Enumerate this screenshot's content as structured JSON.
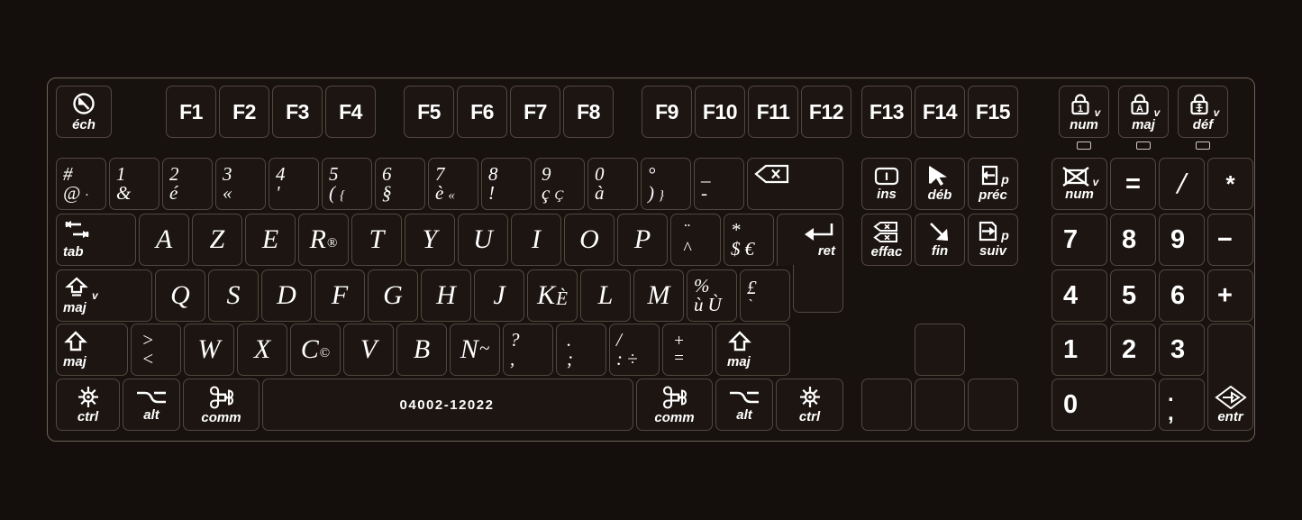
{
  "device": {
    "title": "French AZERTY Apple keyboard sticker overlay",
    "part_number": "04002-12022",
    "background_color": "#140f0c",
    "key_fill_color": "#1c1511",
    "key_border_color": "#52483f",
    "label_color": "#ffffff"
  },
  "function_row": {
    "escape": {
      "label": "éch",
      "icon": "escape-circle-arrow-icon"
    },
    "group_1": [
      "F1",
      "F2",
      "F3",
      "F4"
    ],
    "group_2": [
      "F5",
      "F6",
      "F7",
      "F8"
    ],
    "group_3": [
      "F9",
      "F10",
      "F11",
      "F12"
    ],
    "group_4": [
      "F13",
      "F14",
      "F15"
    ],
    "locks": [
      {
        "label": "num",
        "inner": "1",
        "tag": "v",
        "icon": "padlock-num-icon",
        "led": true
      },
      {
        "label": "maj",
        "inner": "A",
        "tag": "v",
        "icon": "padlock-caps-icon",
        "led": true
      },
      {
        "label": "déf",
        "inner": "",
        "tag": "v",
        "icon": "padlock-scroll-icon",
        "led": true
      }
    ]
  },
  "number_row": [
    {
      "upper": "#",
      "lower": "@",
      "extra_lower": "·"
    },
    {
      "upper": "1",
      "lower": "&"
    },
    {
      "upper": "2",
      "lower": "é"
    },
    {
      "upper": "3",
      "lower": "«"
    },
    {
      "upper": "4",
      "lower": "'"
    },
    {
      "upper": "5",
      "lower": "(",
      "extra_lower": "{"
    },
    {
      "upper": "6",
      "lower": "§"
    },
    {
      "upper": "7",
      "lower": "è",
      "extra_lower": "«"
    },
    {
      "upper": "8",
      "lower": "!"
    },
    {
      "upper": "9",
      "lower": "ç",
      "extra_lower": "Ç"
    },
    {
      "upper": "0",
      "lower": "à"
    },
    {
      "upper": "°",
      "lower": ")",
      "extra_lower": "}"
    },
    {
      "upper": "_",
      "lower": "-"
    }
  ],
  "backspace": {
    "icon": "backspace-arrow-x-icon",
    "label": ""
  },
  "row_azerty": {
    "tab": {
      "label": "tab",
      "icon": "tab-arrows-icon"
    },
    "keys": [
      {
        "letter": "A"
      },
      {
        "letter": "Z"
      },
      {
        "letter": "E"
      },
      {
        "letter": "R",
        "mark": "®"
      },
      {
        "letter": "T"
      },
      {
        "letter": "Y"
      },
      {
        "letter": "U"
      },
      {
        "letter": "I"
      },
      {
        "letter": "O"
      },
      {
        "letter": "P"
      }
    ],
    "dead_key": {
      "upper": "¨",
      "lower": "^"
    },
    "currency_key": {
      "upper": "*",
      "lower": "$",
      "extra_lower": "€"
    },
    "return": {
      "label": "ret",
      "icon": "return-arrow-icon"
    }
  },
  "row_home": {
    "caps_lock": {
      "label": "maj",
      "tag": "v",
      "icon": "caps-lock-outline-arrow-icon"
    },
    "keys": [
      {
        "letter": "Q"
      },
      {
        "letter": "S"
      },
      {
        "letter": "D"
      },
      {
        "letter": "F"
      },
      {
        "letter": "G"
      },
      {
        "letter": "H"
      },
      {
        "letter": "J"
      },
      {
        "letter": "K",
        "accent": "È"
      },
      {
        "letter": "L"
      },
      {
        "letter": "M"
      }
    ],
    "percent_key": {
      "upper": "%",
      "lower": "ù",
      "extra_lower": "Ù"
    },
    "pound_key": {
      "upper": "£",
      "lower": "`"
    }
  },
  "row_bottom": {
    "shift_left": {
      "label": "maj",
      "icon": "shift-arrow-icon"
    },
    "angle_key": {
      "upper": ">",
      "lower": "<"
    },
    "keys": [
      {
        "letter": "W"
      },
      {
        "letter": "X"
      },
      {
        "letter": "C",
        "mark": "©"
      },
      {
        "letter": "V"
      },
      {
        "letter": "B"
      },
      {
        "letter": "N",
        "mark": "~"
      }
    ],
    "punct": [
      {
        "upper": "?",
        "lower": ","
      },
      {
        "upper": ".",
        "lower": ";"
      },
      {
        "upper": "/",
        "lower": ":",
        "extra_lower": "÷"
      },
      {
        "upper": "+",
        "lower": "="
      }
    ],
    "shift_right": {
      "label": "maj",
      "icon": "shift-arrow-icon"
    }
  },
  "row_modifiers": {
    "ctrl_left": {
      "label": "ctrl",
      "icon": "control-wheel-icon"
    },
    "alt_left": {
      "label": "alt",
      "icon": "option-alt-icon"
    },
    "command_left": {
      "label": "comm",
      "icon": "command-icon"
    },
    "space": {
      "label": "04002-12022"
    },
    "command_right": {
      "label": "comm",
      "icon": "command-icon"
    },
    "alt_right": {
      "label": "alt",
      "icon": "option-alt-icon"
    },
    "ctrl_right": {
      "label": "ctrl",
      "icon": "control-wheel-icon"
    }
  },
  "nav_cluster": [
    {
      "label": "ins",
      "icon": "insert-i-box-icon"
    },
    {
      "label": "déb",
      "icon": "home-cursor-arrow-icon"
    },
    {
      "label": "préc",
      "tag": "p",
      "icon": "page-up-icon"
    },
    {
      "label": "effac",
      "icon": "delete-two-boxes-x-icon"
    },
    {
      "label": "fin",
      "icon": "end-diagonal-arrow-icon"
    },
    {
      "label": "suiv",
      "tag": "p",
      "icon": "page-down-icon"
    }
  ],
  "arrow_cluster": {
    "up": "",
    "left": "",
    "down": "",
    "right": ""
  },
  "numpad": {
    "clear": {
      "label": "num",
      "tag": "v",
      "icon": "num-clear-crossed-icon"
    },
    "equals": "=",
    "divide": "/",
    "multiply": "*",
    "row_789": [
      "7",
      "8",
      "9"
    ],
    "minus": "−",
    "row_456": [
      "4",
      "5",
      "6"
    ],
    "plus": "+",
    "row_123": [
      "1",
      "2",
      "3"
    ],
    "zero": "0",
    "decimal": {
      "upper": ".",
      "lower": ","
    },
    "enter": {
      "label": "entr",
      "icon": "enter-diamond-arrow-icon"
    }
  }
}
